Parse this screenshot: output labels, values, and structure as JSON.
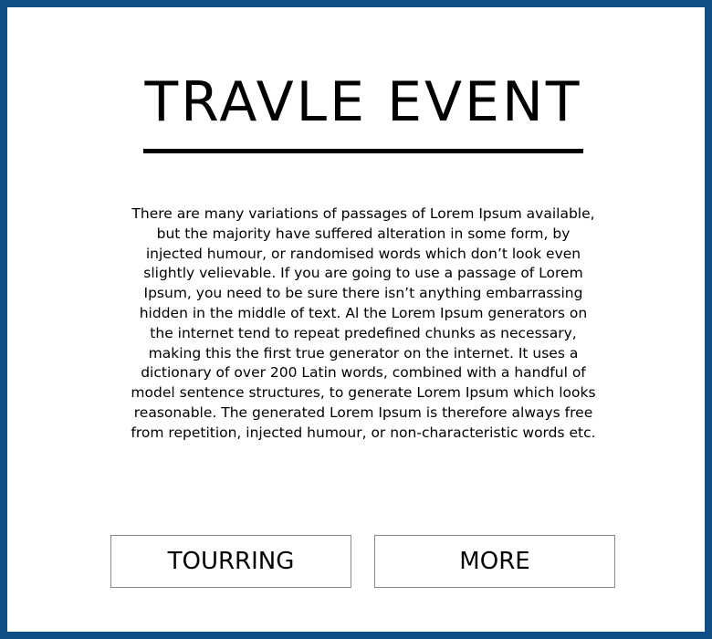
{
  "page": {
    "title": "TRAVLE EVENT",
    "body": "There are many variations of passages of Lorem Ipsum available, but the majority have suffered alteration in some form, by injected humour, or randomised words which don’t look even slightly velievable. If you are going to use a passage of Lorem Ipsum, you need to be sure there isn’t anything embarrassing hidden in the middle of text. Al the Lorem Ipsum generators on the internet tend to repeat predefined chunks as necessary, making this the first true generator on the internet. It uses a dictionary of over 200 Latin words, combined with a handful of model sentence structures, to generate Lorem Ipsum which looks reasonable. The generated Lorem Ipsum is therefore always free from repetition, injected humour, or non-characteristic words etc.",
    "buttons": {
      "touring_label": "TOURRING",
      "more_label": "MORE"
    }
  },
  "colors": {
    "frame_border": "#0d4f86",
    "background": "#ffffff",
    "text": "#000000",
    "button_border": "#8a8a8a"
  }
}
